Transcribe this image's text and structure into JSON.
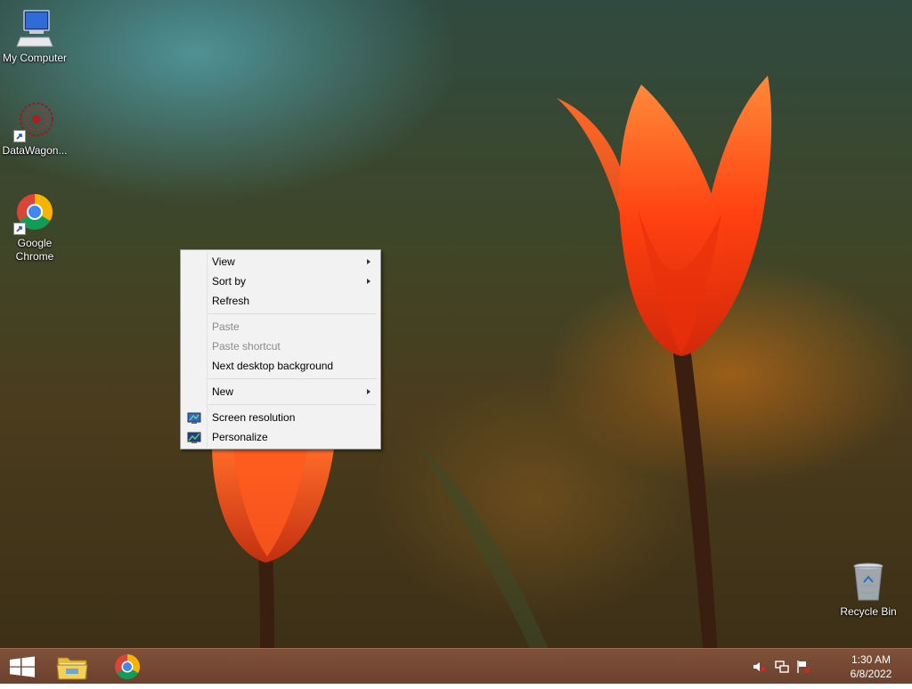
{
  "desktop": {
    "icons": [
      {
        "label": "My Computer",
        "icon": "my-computer-icon"
      },
      {
        "label": "DataWagon...",
        "icon": "datawagon-icon"
      },
      {
        "label": "Google Chrome",
        "icon": "chrome-icon"
      },
      {
        "label": "Recycle Bin",
        "icon": "recycle-bin-icon"
      }
    ]
  },
  "context_menu": {
    "items": [
      {
        "label": "View",
        "submenu": true,
        "enabled": true
      },
      {
        "label": "Sort by",
        "submenu": true,
        "enabled": true
      },
      {
        "label": "Refresh",
        "enabled": true
      },
      {
        "label": "Paste",
        "enabled": false
      },
      {
        "label": "Paste shortcut",
        "enabled": false
      },
      {
        "label": "Next desktop background",
        "enabled": true
      },
      {
        "label": "New",
        "submenu": true,
        "enabled": true
      },
      {
        "label": "Screen resolution",
        "icon": "screen-resolution-icon",
        "enabled": true
      },
      {
        "label": "Personalize",
        "icon": "personalize-icon",
        "enabled": true
      }
    ]
  },
  "taskbar": {
    "pinned": [
      {
        "name": "start",
        "icon": "windows-logo-icon"
      },
      {
        "name": "file-explorer",
        "icon": "folder-icon"
      },
      {
        "name": "chrome",
        "icon": "chrome-icon"
      }
    ],
    "tray_icons": [
      "volume-muted-icon",
      "network-icon",
      "action-center-flag-icon"
    ],
    "clock": {
      "time": "1:30 AM",
      "date": "6/8/2022"
    }
  },
  "colors": {
    "taskbar": "#7a4a34",
    "menu_bg": "#f2f2f2",
    "tulip": "#ff4a14"
  }
}
